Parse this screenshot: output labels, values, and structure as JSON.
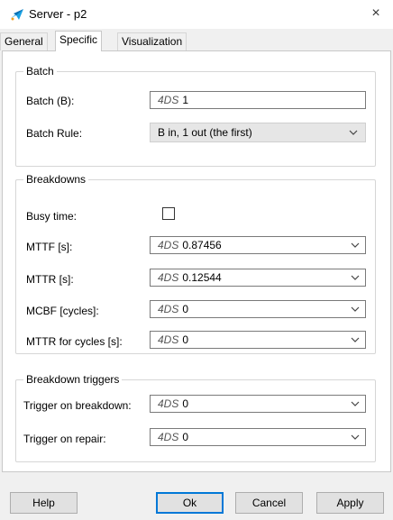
{
  "window": {
    "title": "Server - p2",
    "close_glyph": "×"
  },
  "tabs": [
    {
      "label": "General",
      "active": false
    },
    {
      "label": "Specific",
      "active": true
    },
    {
      "label": "Visualization",
      "active": false
    }
  ],
  "batch": {
    "title": "Batch",
    "batch_label": "Batch (B):",
    "batch_prefix": "4DS",
    "batch_value": "1",
    "rule_label": "Batch Rule:",
    "rule_value": "B in, 1 out (the first)"
  },
  "breakdowns": {
    "title": "Breakdowns",
    "busy_label": "Busy time:",
    "busy_checked": false,
    "rows": [
      {
        "label": "MTTF [s]:",
        "prefix": "4DS",
        "value": "0.87456"
      },
      {
        "label": "MTTR [s]:",
        "prefix": "4DS",
        "value": "0.12544"
      },
      {
        "label": "MCBF [cycles]:",
        "prefix": "4DS",
        "value": "0"
      },
      {
        "label": "MTTR for cycles [s]:",
        "prefix": "4DS",
        "value": "0"
      }
    ]
  },
  "triggers": {
    "title": "Breakdown triggers",
    "rows": [
      {
        "label": "Trigger on breakdown:",
        "prefix": "4DS",
        "value": "0"
      },
      {
        "label": "Trigger on repair:",
        "prefix": "4DS",
        "value": "0"
      }
    ]
  },
  "buttons": {
    "help": "Help",
    "ok": "Ok",
    "cancel": "Cancel",
    "apply": "Apply"
  },
  "icons": {
    "app": "server-app-icon",
    "chevron": "chevron-down-icon"
  },
  "colors": {
    "accent": "#0078d7",
    "icon_blue": "#1ba1e2"
  }
}
